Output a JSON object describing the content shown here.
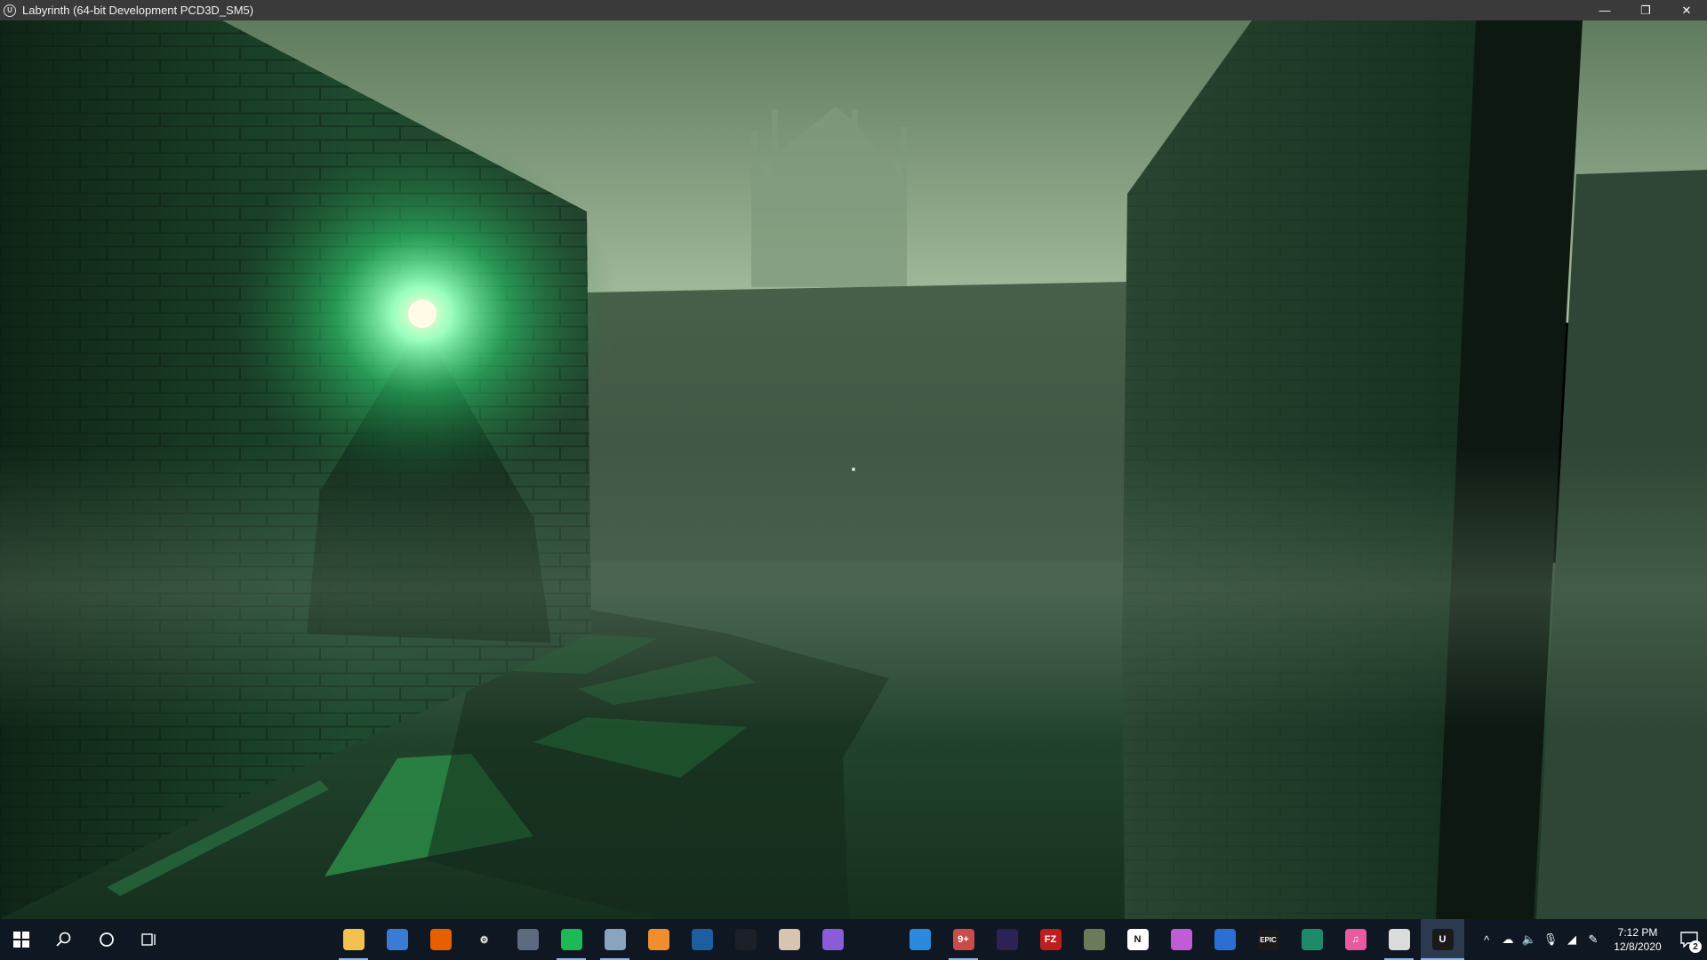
{
  "window": {
    "title": "Labyrinth (64-bit Development PCD3D_SM5)",
    "app_icon_letter": "U",
    "minimize_glyph": "—",
    "restore_glyph": "❐",
    "close_glyph": "✕"
  },
  "scene": {
    "description_colors": {
      "sky_top": "#6d8a6b",
      "sky_bottom": "#a9bfa2",
      "fog": "#4d6650",
      "wall_light": "#27573a",
      "wall_dark": "#132a1c",
      "glow": "#3cff8a",
      "ground": "#1c3a26"
    }
  },
  "taskbar": {
    "apps": [
      {
        "name": "file-explorer",
        "label": "",
        "color": "#f2c14e",
        "running": true
      },
      {
        "name": "files",
        "label": "",
        "color": "#3a7bd5",
        "running": false
      },
      {
        "name": "firefox",
        "label": "",
        "color": "#e66000",
        "running": false
      },
      {
        "name": "settings",
        "label": "⚙",
        "color": "#0f1722",
        "running": false
      },
      {
        "name": "calculator",
        "label": "",
        "color": "#5c6b7f",
        "running": false
      },
      {
        "name": "spotify",
        "label": "",
        "color": "#1db954",
        "running": true
      },
      {
        "name": "photo-app",
        "label": "",
        "color": "#8aa4c0",
        "running": true
      },
      {
        "name": "git-app",
        "label": "",
        "color": "#f08d2f",
        "running": false
      },
      {
        "name": "steam",
        "label": "",
        "color": "#1b5fa0",
        "running": false
      },
      {
        "name": "destiny",
        "label": "",
        "color": "#1a1f28",
        "running": false
      },
      {
        "name": "anime-app",
        "label": "",
        "color": "#d8c4b0",
        "running": false
      },
      {
        "name": "visual-studio",
        "label": "",
        "color": "#8a5cd8",
        "running": false
      },
      {
        "name": "unity",
        "label": "",
        "color": "#0f1722",
        "running": false
      },
      {
        "name": "vscode",
        "label": "",
        "color": "#2a8bde",
        "running": false
      },
      {
        "name": "discord-app",
        "label": "9+",
        "color": "#c94b4b",
        "running": true
      },
      {
        "name": "eclipse",
        "label": "",
        "color": "#2c2255",
        "running": false
      },
      {
        "name": "filezilla",
        "label": "FZ",
        "color": "#bf1e1e",
        "running": false
      },
      {
        "name": "image-viewer",
        "label": "",
        "color": "#6a7b5a",
        "running": false
      },
      {
        "name": "notion",
        "label": "N",
        "color": "#ffffff",
        "running": false
      },
      {
        "name": "browser-orb",
        "label": "",
        "color": "#c05cd8",
        "running": false
      },
      {
        "name": "remote-app",
        "label": "",
        "color": "#2a6fd6",
        "running": false
      },
      {
        "name": "epic-games",
        "label": "EPIC",
        "color": "#1a1a1a",
        "running": false
      },
      {
        "name": "globe-app",
        "label": "",
        "color": "#1f8a6a",
        "running": false
      },
      {
        "name": "itunes",
        "label": "♫",
        "color": "#e85aa0",
        "running": false
      },
      {
        "name": "unreal-engine",
        "label": "",
        "color": "#dcdcdc",
        "running": true
      },
      {
        "name": "unreal-game",
        "label": "U",
        "color": "#1a1a1a",
        "running": true
      }
    ],
    "tray": {
      "chevron": "^",
      "cloud": "☁",
      "volume": "🔈",
      "mic": "🎙",
      "network": "◢",
      "pen": "✎",
      "time": "7:12 PM",
      "date": "12/8/2020",
      "notification_count": "2"
    }
  }
}
